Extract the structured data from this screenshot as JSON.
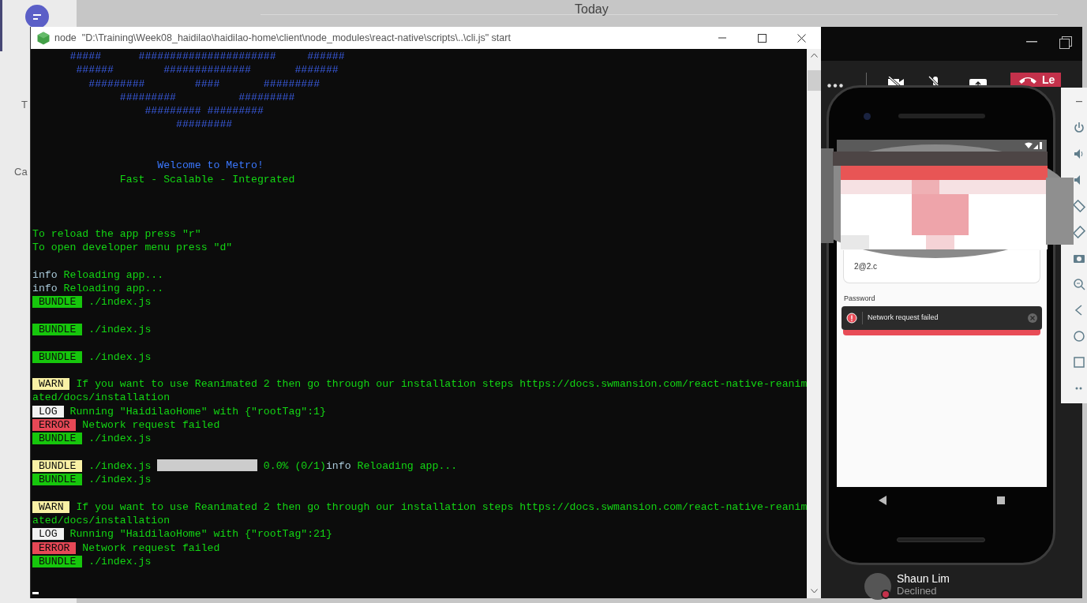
{
  "background_app": {
    "header_title": "Today",
    "rail_labels": [
      "T",
      "Ca"
    ]
  },
  "terminal": {
    "title": "node  \"D:\\Training\\Week08_haidilao\\haidilao-home\\client\\node_modules\\react-native\\scripts\\..\\cli.js\" start",
    "lines": [
      {
        "kind": "art",
        "text": "      #####      ######################     ######"
      },
      {
        "kind": "art",
        "text": "       ######        ##############       #######"
      },
      {
        "kind": "art",
        "text": "         #########        ####       #########"
      },
      {
        "kind": "art",
        "text": "              #########          #########"
      },
      {
        "kind": "art",
        "text": "                  ######### #########"
      },
      {
        "kind": "art",
        "text": "                       #########"
      },
      {
        "kind": "blank"
      },
      {
        "kind": "blank"
      },
      {
        "kind": "title",
        "text": "                    Welcome to Metro!"
      },
      {
        "kind": "text",
        "text": "              Fast - Scalable - Integrated"
      },
      {
        "kind": "blank"
      },
      {
        "kind": "blank"
      },
      {
        "kind": "blank"
      },
      {
        "kind": "text",
        "text": "To reload the app press \"r\""
      },
      {
        "kind": "text",
        "text": "To open developer menu press \"d\""
      },
      {
        "kind": "blank"
      },
      {
        "kind": "info",
        "prefix": "info",
        "text": "Reloading app..."
      },
      {
        "kind": "info",
        "prefix": "info",
        "text": "Reloading app..."
      },
      {
        "kind": "tagged",
        "tag": {
          "label": "BUNDLE",
          "color": "#16c60c"
        },
        "text": "./index.js"
      },
      {
        "kind": "blank"
      },
      {
        "kind": "tagged",
        "tag": {
          "label": "BUNDLE",
          "color": "#16c60c"
        },
        "text": "./index.js"
      },
      {
        "kind": "blank"
      },
      {
        "kind": "tagged",
        "tag": {
          "label": "BUNDLE",
          "color": "#16c60c"
        },
        "text": "./index.js"
      },
      {
        "kind": "blank"
      },
      {
        "kind": "tagged",
        "tag": {
          "label": "WARN",
          "color": "#f9f1a5"
        },
        "text": "If you want to use Reanimated 2 then go through our installation steps https://docs.swmansion.com/react-native-reanim"
      },
      {
        "kind": "text",
        "text": "ated/docs/installation"
      },
      {
        "kind": "tagged",
        "tag": {
          "label": "LOG",
          "color": "#f2f2f2"
        },
        "text": "Running \"HaidilaoHome\" with {\"rootTag\":1}"
      },
      {
        "kind": "tagged",
        "tag": {
          "label": "ERROR",
          "color": "#e74856"
        },
        "text": "Network request failed"
      },
      {
        "kind": "tagged",
        "tag": {
          "label": "BUNDLE",
          "color": "#16c60c"
        },
        "text": "./index.js"
      },
      {
        "kind": "blank"
      },
      {
        "kind": "progress",
        "tag": {
          "label": "BUNDLE",
          "color": "#f9f1a5"
        },
        "text": "./index.js",
        "level": 0,
        "reading": "0.0% (0/1)",
        "info_prefix": "info",
        "info_text": "Reloading app..."
      },
      {
        "kind": "tagged",
        "tag": {
          "label": "BUNDLE",
          "color": "#16c60c"
        },
        "text": "./index.js"
      },
      {
        "kind": "blank"
      },
      {
        "kind": "tagged",
        "tag": {
          "label": "WARN",
          "color": "#f9f1a5"
        },
        "text": "If you want to use Reanimated 2 then go through our installation steps https://docs.swmansion.com/react-native-reanim"
      },
      {
        "kind": "text",
        "text": "ated/docs/installation"
      },
      {
        "kind": "tagged",
        "tag": {
          "label": "LOG",
          "color": "#f2f2f2"
        },
        "text": "Running \"HaidilaoHome\" with {\"rootTag\":21}"
      },
      {
        "kind": "tagged",
        "tag": {
          "label": "ERROR",
          "color": "#e74856"
        },
        "text": "Network request failed"
      },
      {
        "kind": "tagged",
        "tag": {
          "label": "BUNDLE",
          "color": "#16c60c"
        },
        "text": "./index.js"
      },
      {
        "kind": "blank"
      },
      {
        "kind": "cursor"
      }
    ]
  },
  "meeting": {
    "leave_button": "Le",
    "participant": {
      "name": "Shaun Lim",
      "status": "Declined"
    }
  },
  "emulator": {
    "screen": {
      "email_value": "2@2.c",
      "password_label": "Password",
      "toast": "Network request failed"
    }
  }
}
